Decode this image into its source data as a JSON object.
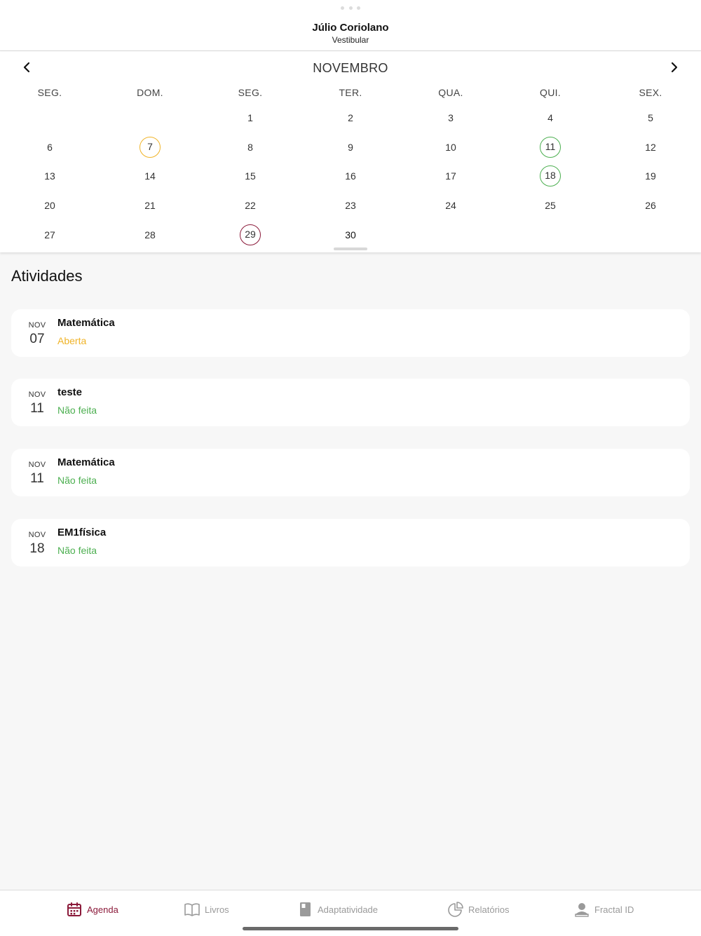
{
  "header": {
    "name": "Júlio Coriolano",
    "subtitle": "Vestibular"
  },
  "calendar": {
    "month": "NOVEMBRO",
    "weekdays": [
      "SEG.",
      "DOM.",
      "SEG.",
      "TER.",
      "QUA.",
      "QUI.",
      "SEX."
    ],
    "days": {
      "d1": "1",
      "d2": "2",
      "d3": "3",
      "d4": "4",
      "d5": "5",
      "d6": "6",
      "d7": "7",
      "d8": "8",
      "d9": "9",
      "d10": "10",
      "d11": "11",
      "d12": "12",
      "d13": "13",
      "d14": "14",
      "d15": "15",
      "d16": "16",
      "d17": "17",
      "d18": "18",
      "d19": "19",
      "d20": "20",
      "d21": "21",
      "d22": "22",
      "d23": "23",
      "d24": "24",
      "d25": "25",
      "d26": "26",
      "d27": "27",
      "d28": "28",
      "d29": "29",
      "d30": "30"
    }
  },
  "activities": {
    "title": "Atividades",
    "items": [
      {
        "month": "NOV",
        "day": "07",
        "title": "Matemática",
        "status": "Aberta"
      },
      {
        "month": "NOV",
        "day": "11",
        "title": "teste",
        "status": "Não feita"
      },
      {
        "month": "NOV",
        "day": "11",
        "title": "Matemática",
        "status": "Não feita"
      },
      {
        "month": "NOV",
        "day": "18",
        "title": "EM1física",
        "status": "Não feita"
      }
    ]
  },
  "tabs": [
    {
      "label": "Agenda",
      "icon": "calendar-icon",
      "active": true
    },
    {
      "label": "Livros",
      "icon": "book-icon"
    },
    {
      "label": "Adaptatividade",
      "icon": "notebook-icon"
    },
    {
      "label": "Relatórios",
      "icon": "pie-chart-icon"
    },
    {
      "label": "Fractal ID",
      "icon": "user-icon"
    }
  ],
  "colors": {
    "accent": "#8b1a3a",
    "open": "#f0b429",
    "done": "#4caf50",
    "inactive": "#9a9a9a"
  }
}
